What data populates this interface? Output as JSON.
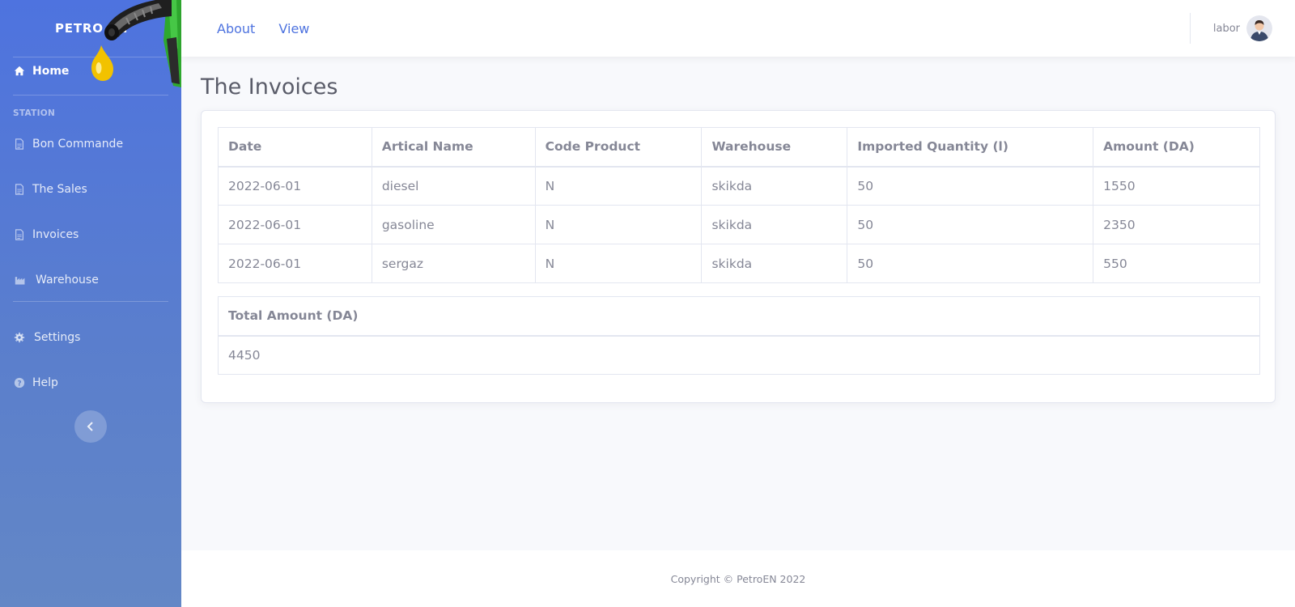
{
  "sidebar": {
    "brand": "PETRO EN",
    "home": "Home",
    "heading": "STATION",
    "items": [
      {
        "label": "Bon Commande",
        "icon": "file-icon"
      },
      {
        "label": "The Sales",
        "icon": "file-icon"
      },
      {
        "label": "Invoices",
        "icon": "file-icon"
      },
      {
        "label": "Warehouse",
        "icon": "industry-icon"
      }
    ],
    "settings": "Settings",
    "help": "Help"
  },
  "topbar": {
    "links": [
      "About",
      "View"
    ],
    "username": "labor"
  },
  "page": {
    "title": "The Invoices"
  },
  "invoices": {
    "headers": [
      "Date",
      "Artical Name",
      "Code Product",
      "Warehouse",
      "Imported Quantity (l)",
      "Amount (DA)"
    ],
    "rows": [
      [
        "2022-06-01",
        "diesel",
        "N",
        "skikda",
        "50",
        "1550"
      ],
      [
        "2022-06-01",
        "gasoline",
        "N",
        "skikda",
        "50",
        "2350"
      ],
      [
        "2022-06-01",
        "sergaz",
        "N",
        "skikda",
        "50",
        "550"
      ]
    ]
  },
  "total": {
    "header": "Total Amount (DA)",
    "value": "4450"
  },
  "footer": {
    "copyright": "Copyright © PetroEN 2022"
  },
  "colors": {
    "primary": "#4e73df",
    "text": "#858796",
    "title": "#5a5c69"
  }
}
